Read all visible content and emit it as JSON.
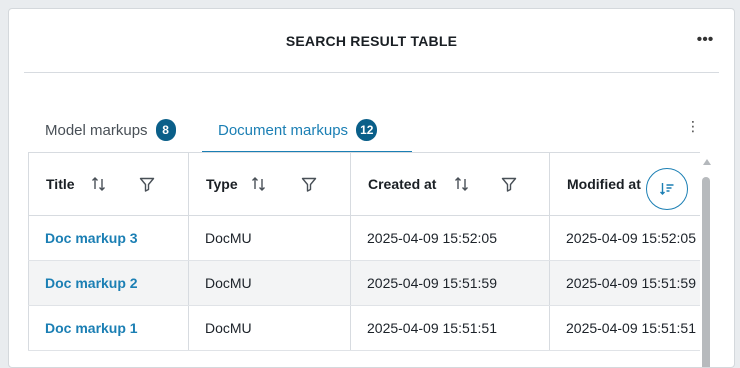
{
  "panel": {
    "title": "SEARCH RESULT TABLE",
    "more_label": "•••"
  },
  "tabs": [
    {
      "label": "Model markups",
      "count": "8",
      "active": false
    },
    {
      "label": "Document markups",
      "count": "12",
      "active": true
    }
  ],
  "tab_more_label": "⋮",
  "table": {
    "columns": [
      {
        "label": "Title",
        "sortable": true,
        "filterable": true
      },
      {
        "label": "Type",
        "sortable": true,
        "filterable": true
      },
      {
        "label": "Created at",
        "sortable": true,
        "filterable": true
      },
      {
        "label": "Modified at",
        "sortable": true,
        "sort_active": "descending"
      }
    ],
    "rows": [
      {
        "title": "Doc markup 3",
        "type": "DocMU",
        "created": "2025-04-09 15:52:05",
        "modified": "2025-04-09 15:52:05"
      },
      {
        "title": "Doc markup 2",
        "type": "DocMU",
        "created": "2025-04-09 15:51:59",
        "modified": "2025-04-09 15:51:59"
      },
      {
        "title": "Doc markup 1",
        "type": "DocMU",
        "created": "2025-04-09 15:51:51",
        "modified": "2025-04-09 15:51:51"
      }
    ]
  },
  "colors": {
    "accent": "#1b7fb4",
    "badge": "#0a5f89"
  }
}
